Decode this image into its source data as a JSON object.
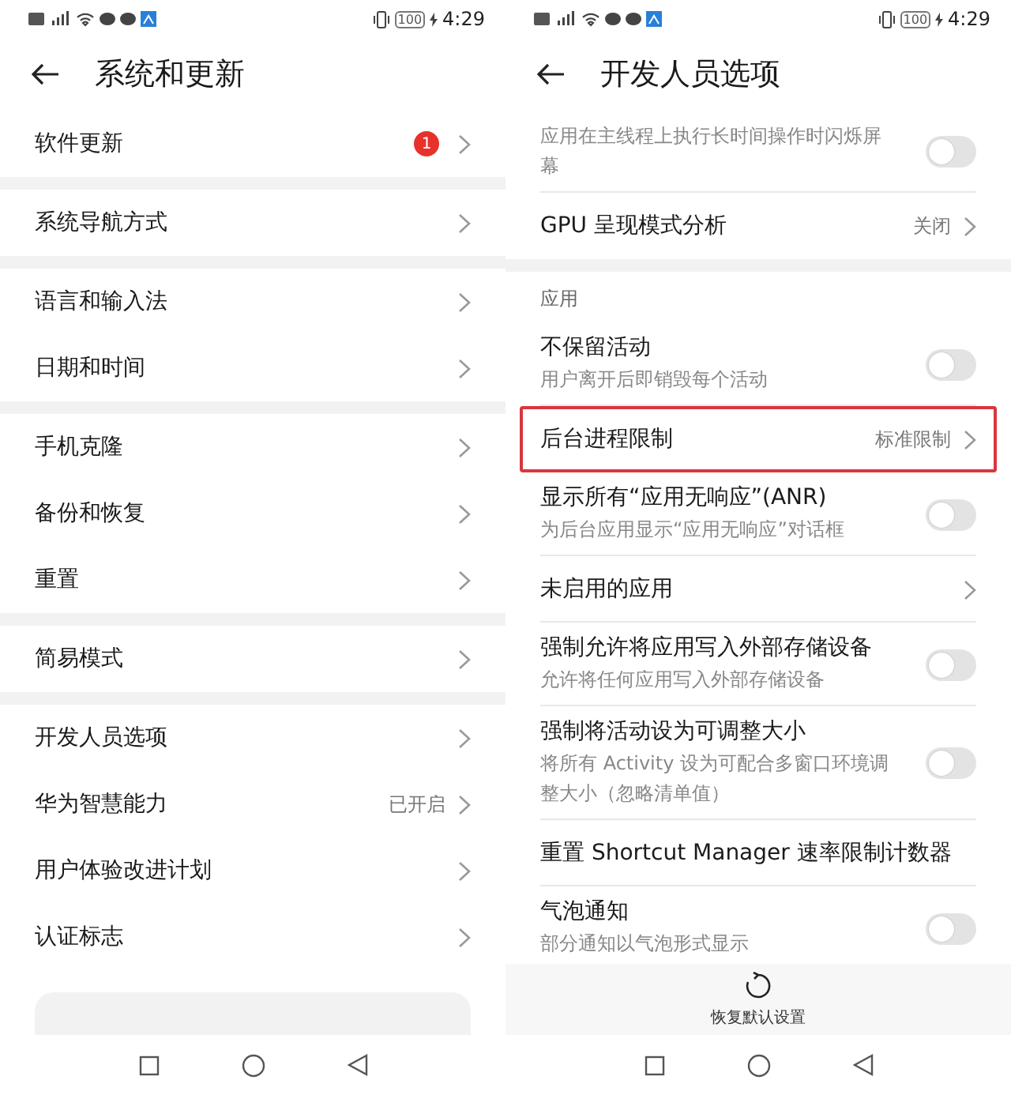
{
  "screens": [
    {
      "status_bar": {
        "battery": "100",
        "time": "4:29"
      },
      "title": "系统和更新",
      "dividers": false,
      "groups": [
        {
          "rows": [
            {
              "kind": "link",
              "title": "软件更新",
              "badge": "1",
              "highlighted": false
            }
          ]
        },
        {
          "rows": [
            {
              "kind": "link",
              "title": "系统导航方式",
              "highlighted": false
            }
          ]
        },
        {
          "rows": [
            {
              "kind": "link",
              "title": "语言和输入法",
              "highlighted": false
            },
            {
              "kind": "link",
              "title": "日期和时间",
              "highlighted": false
            }
          ]
        },
        {
          "rows": [
            {
              "kind": "link",
              "title": "手机克隆",
              "highlighted": false
            },
            {
              "kind": "link",
              "title": "备份和恢复",
              "highlighted": false
            },
            {
              "kind": "link",
              "title": "重置",
              "highlighted": false
            }
          ]
        },
        {
          "rows": [
            {
              "kind": "link",
              "title": "简易模式",
              "highlighted": false
            }
          ]
        },
        {
          "rows": [
            {
              "kind": "link",
              "title": "开发人员选项",
              "highlighted": false
            },
            {
              "kind": "link",
              "title": "华为智慧能力",
              "value": "已开启",
              "highlighted": false
            },
            {
              "kind": "link",
              "title": "用户体验改进计划",
              "highlighted": false
            },
            {
              "kind": "link",
              "title": "认证标志",
              "highlighted": false
            }
          ]
        }
      ],
      "bottom": {
        "kind": "card"
      }
    },
    {
      "status_bar": {
        "battery": "100",
        "time": "4:29"
      },
      "title": "开发人员选项",
      "dividers": true,
      "groups": [
        {
          "rows": [
            {
              "kind": "toggle",
              "subtitle": "应用在主线程上执行长时间操作时闪烁屏幕",
              "on": false,
              "highlighted": false
            },
            {
              "kind": "link",
              "title": "GPU 呈现模式分析",
              "value": "关闭",
              "highlighted": false
            }
          ]
        },
        {
          "header": "应用",
          "rows": [
            {
              "kind": "toggle",
              "title": "不保留活动",
              "subtitle": "用户离开后即销毁每个活动",
              "on": false,
              "highlighted": false
            },
            {
              "kind": "link",
              "title": "后台进程限制",
              "value": "标准限制",
              "highlighted": true
            },
            {
              "kind": "toggle",
              "title": "显示所有“应用无响应”(ANR)",
              "subtitle": "为后台应用显示“应用无响应”对话框",
              "on": false,
              "highlighted": false
            },
            {
              "kind": "link",
              "title": "未启用的应用",
              "highlighted": false
            },
            {
              "kind": "toggle",
              "title": "强制允许将应用写入外部存储设备",
              "subtitle": "允许将任何应用写入外部存储设备",
              "on": false,
              "highlighted": false
            },
            {
              "kind": "toggle",
              "title": "强制将活动设为可调整大小",
              "subtitle": "将所有 Activity 设为可配合多窗口环境调整大小（忽略清单值）",
              "on": false,
              "highlighted": false
            },
            {
              "kind": "plain",
              "title": "重置 Shortcut Manager 速率限制计数器",
              "highlighted": false
            },
            {
              "kind": "toggle",
              "title": "气泡通知",
              "subtitle": "部分通知以气泡形式显示",
              "on": false,
              "highlighted": false
            }
          ]
        }
      ],
      "bottom": {
        "kind": "action",
        "label": "恢复默认设置"
      }
    }
  ]
}
